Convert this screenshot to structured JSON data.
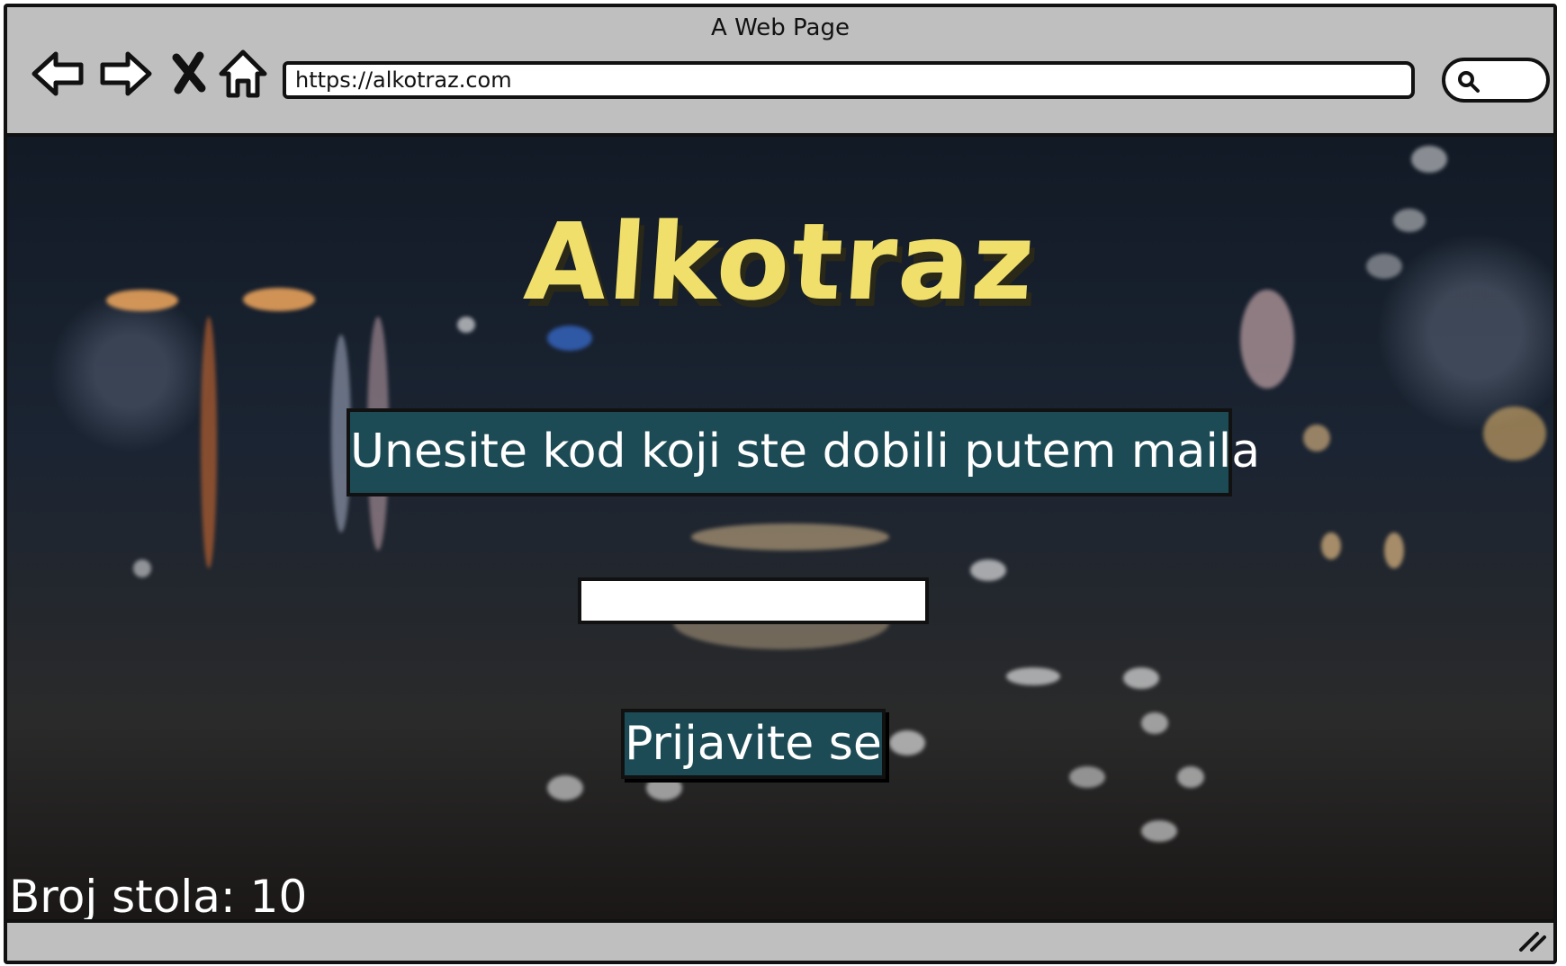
{
  "window": {
    "title": "A Web Page"
  },
  "toolbar": {
    "back_icon": "arrow-left-icon",
    "forward_icon": "arrow-right-icon",
    "stop_icon": "close-icon",
    "home_icon": "home-icon",
    "url": "https://alkotraz.com",
    "search_icon": "search-icon"
  },
  "page": {
    "logo": "Alkotraz",
    "prompt": "Unesite kod koji ste dobili putem maila",
    "code_input": {
      "value": "",
      "placeholder": ""
    },
    "login_button": "Prijavite se",
    "table_number": "Broj stola: 10"
  },
  "colors": {
    "logo": "#f0df6a",
    "panel": "#1d4b55",
    "chrome": "#bfbfbf"
  }
}
